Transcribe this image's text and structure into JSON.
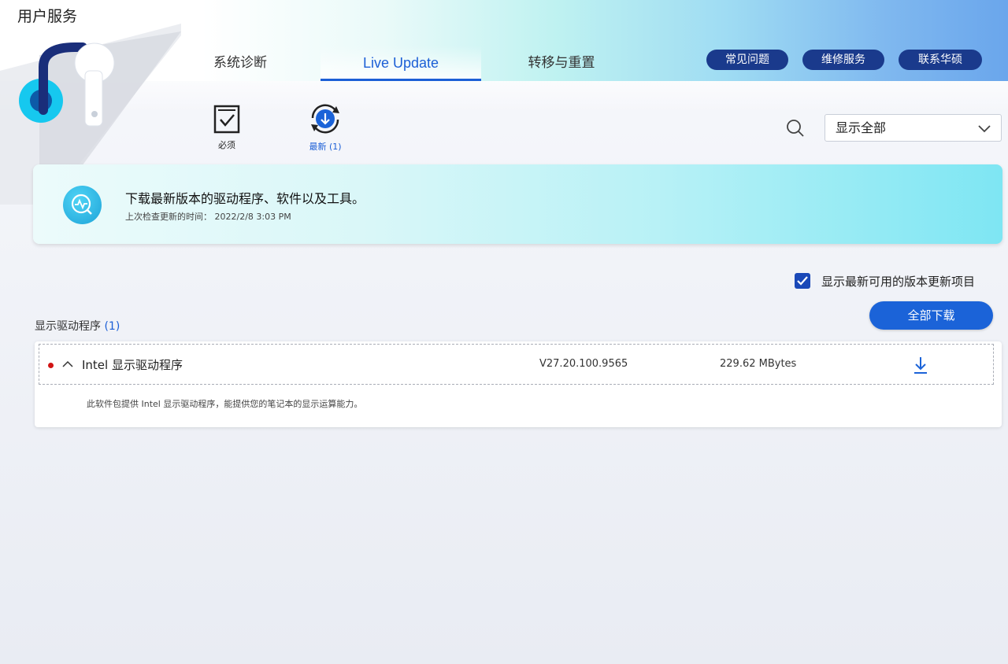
{
  "app": {
    "title": "用户服务"
  },
  "tabs": [
    {
      "label": "系统诊断"
    },
    {
      "label": "Live Update"
    },
    {
      "label": "转移与重置"
    }
  ],
  "header_buttons": [
    {
      "label": "常见问题"
    },
    {
      "label": "维修服务"
    },
    {
      "label": "联系华硕"
    }
  ],
  "toolbar": {
    "required_label": "必须",
    "latest_label": "最新",
    "latest_count": "(1)",
    "filter_value": "显示全部"
  },
  "banner": {
    "title": "下载最新版本的驱动程序、软件以及工具。",
    "last_check_label": "上次检查更新的时间：",
    "last_check_time": "2022/2/8  3:03 PM"
  },
  "options": {
    "show_latest_label": "显示最新可用的版本更新项目",
    "show_latest_checked": true,
    "download_all_label": "全部下载"
  },
  "section": {
    "title": "显示驱动程序",
    "count": "(1)"
  },
  "items": [
    {
      "name": "Intel 显示驱动程序",
      "version": "V27.20.100.9565",
      "size": "229.62 MBytes",
      "description": "此软件包提供 Intel 显示驱动程序，能提供您的笔记本的显示运算能力。"
    }
  ],
  "colors": {
    "accent": "#1c5fd6",
    "pill": "#1a3a8c",
    "checkbox": "#1a49b8",
    "status_dot": "#d11414"
  }
}
